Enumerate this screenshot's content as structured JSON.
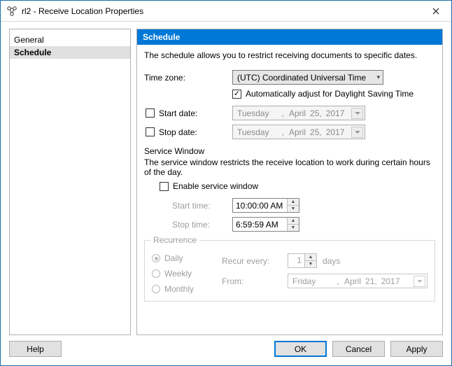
{
  "window": {
    "title": "rl2 - Receive Location Properties"
  },
  "sidebar": {
    "items": [
      {
        "label": "General",
        "selected": false
      },
      {
        "label": "Schedule",
        "selected": true
      }
    ]
  },
  "header": {
    "title": "Schedule"
  },
  "desc": "The schedule allows you to restrict receiving documents to specific dates.",
  "timezone": {
    "label": "Time zone:",
    "value": "(UTC) Coordinated Universal Time",
    "dst_label": "Automatically adjust for Daylight Saving Time",
    "dst_checked": true
  },
  "start_date": {
    "label": "Start date:",
    "checked": false,
    "weekday": "Tuesday",
    "month": "April",
    "day": "25,",
    "year": "2017"
  },
  "stop_date": {
    "label": "Stop date:",
    "checked": false,
    "weekday": "Tuesday",
    "month": "April",
    "day": "25,",
    "year": "2017"
  },
  "service_window": {
    "title": "Service Window",
    "desc": "The service window restricts the receive location to work during certain hours of the day.",
    "enable_label": "Enable service window",
    "enabled": false,
    "start_label": "Start time:",
    "start_value": "10:00:00 AM",
    "stop_label": "Stop time:",
    "stop_value": "6:59:59 AM"
  },
  "recurrence": {
    "legend": "Recurrence",
    "options": [
      {
        "label": "Daily",
        "checked": true
      },
      {
        "label": "Weekly",
        "checked": false
      },
      {
        "label": "Monthly",
        "checked": false
      }
    ],
    "recur_label": "Recur every:",
    "recur_value": "1",
    "recur_unit": "days",
    "from_label": "From:",
    "from_weekday": "Friday",
    "from_month": "April",
    "from_day": "21,",
    "from_year": "2017"
  },
  "buttons": {
    "help": "Help",
    "ok": "OK",
    "cancel": "Cancel",
    "apply": "Apply"
  }
}
